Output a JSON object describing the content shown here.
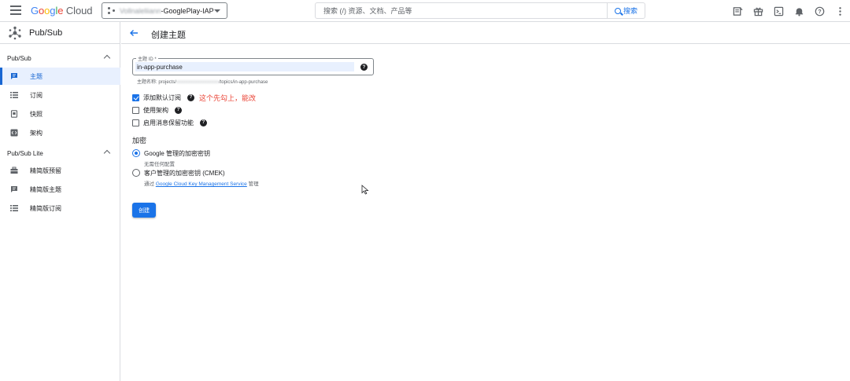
{
  "header": {
    "logo": {
      "letters": [
        "G",
        "o",
        "o",
        "g",
        "l",
        "e"
      ],
      "suffix": "Cloud"
    },
    "project": {
      "name_redacted": "Vollnaleliiann",
      "name_suffix": "-GooglePlay-IAP"
    },
    "search": {
      "placeholder": "搜索 (/) 资源、文档、产品等",
      "button_label": "搜索"
    },
    "icons": [
      "notes-icon",
      "gift-icon",
      "terminal-icon",
      "bell-icon",
      "help-icon",
      "more-vert-icon"
    ]
  },
  "sidebar": {
    "title": "Pub/Sub",
    "groups": [
      {
        "label": "Pub/Sub",
        "expanded": true,
        "items": [
          {
            "label": "主题",
            "icon": "chat-icon",
            "active": true
          },
          {
            "label": "订阅",
            "icon": "list-icon",
            "active": false
          },
          {
            "label": "快照",
            "icon": "snapshot-icon",
            "active": false
          },
          {
            "label": "架构",
            "icon": "schema-icon",
            "active": false
          }
        ]
      },
      {
        "label": "Pub/Sub Lite",
        "expanded": true,
        "items": [
          {
            "label": "精简版预留",
            "icon": "reservation-icon",
            "active": false
          },
          {
            "label": "精简版主题",
            "icon": "chat-icon",
            "active": false
          },
          {
            "label": "精简版订阅",
            "icon": "list-icon",
            "active": false
          }
        ]
      }
    ]
  },
  "page": {
    "title": "创建主题",
    "topic_id": {
      "label": "主题 ID *",
      "value": "in-app-purchase",
      "name_prefix": "主题名称: projects/",
      "name_redacted": "xxxxxxxxxxxxxxxxxx",
      "name_suffix": "/topics/in-app-purchase"
    },
    "options": [
      {
        "label": "添加默认订阅",
        "checked": true,
        "annotation": "这个先勾上，能改"
      },
      {
        "label": "使用架构",
        "checked": false
      },
      {
        "label": "启用消息保留功能",
        "checked": false
      }
    ],
    "encryption": {
      "title": "加密",
      "google_managed": {
        "label": "Google 管理的加密密钥",
        "sub": "无需任何配置",
        "selected": true
      },
      "customer_managed": {
        "label": "客户管理的加密密钥 (CMEK)",
        "sub_prefix": "通过",
        "sub_link": "Google Cloud Key Management Service",
        "sub_suffix": "管理",
        "selected": false
      }
    },
    "create_button": "创建"
  },
  "colors": {
    "accent": "#1a73e8",
    "annotation": "#ea4335",
    "active_bg": "#e8f0fe"
  }
}
